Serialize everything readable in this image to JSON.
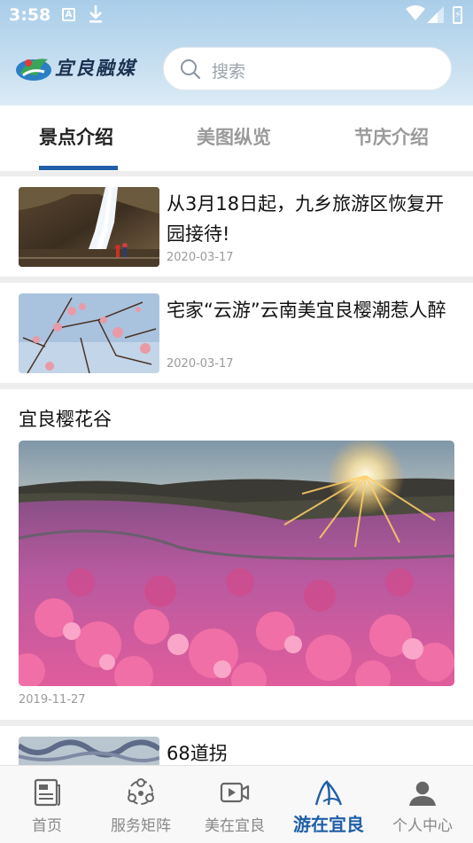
{
  "status_bar": {
    "time": "3:58",
    "a_icon": "A"
  },
  "header": {
    "logo_text": "宜良融媒",
    "search_placeholder": "搜索"
  },
  "tabs": [
    {
      "label": "景点介绍",
      "active": true
    },
    {
      "label": "美图纵览",
      "active": false
    },
    {
      "label": "节庆介绍",
      "active": false
    }
  ],
  "articles": [
    {
      "title": "从3月18日起，九乡旅游区恢复开园接待!",
      "date": "2020-03-17",
      "image": "waterfall-photo"
    },
    {
      "title": "宅家“云游”云南美宜良樱潮惹人醉",
      "date": "2020-03-17",
      "image": "cherry-blossom-branch-photo"
    }
  ],
  "featured": {
    "title": "宜良樱花谷",
    "date": "2019-11-27",
    "image": "cherry-valley-sunset-photo"
  },
  "partial_article": {
    "title": "68道拐",
    "image": "mountain-road-photo"
  },
  "bottom_nav": [
    {
      "label": "首页",
      "icon": "news-icon",
      "active": false
    },
    {
      "label": "服务矩阵",
      "icon": "service-matrix-icon",
      "active": false
    },
    {
      "label": "美在宜良",
      "icon": "video-icon",
      "active": false
    },
    {
      "label": "游在宜良",
      "icon": "travel-icon",
      "active": true
    },
    {
      "label": "个人中心",
      "icon": "user-icon",
      "active": false
    }
  ],
  "colors": {
    "accent": "#1f5fa7",
    "header_gradient_top": "#a9cde9",
    "background": "#ededed"
  }
}
